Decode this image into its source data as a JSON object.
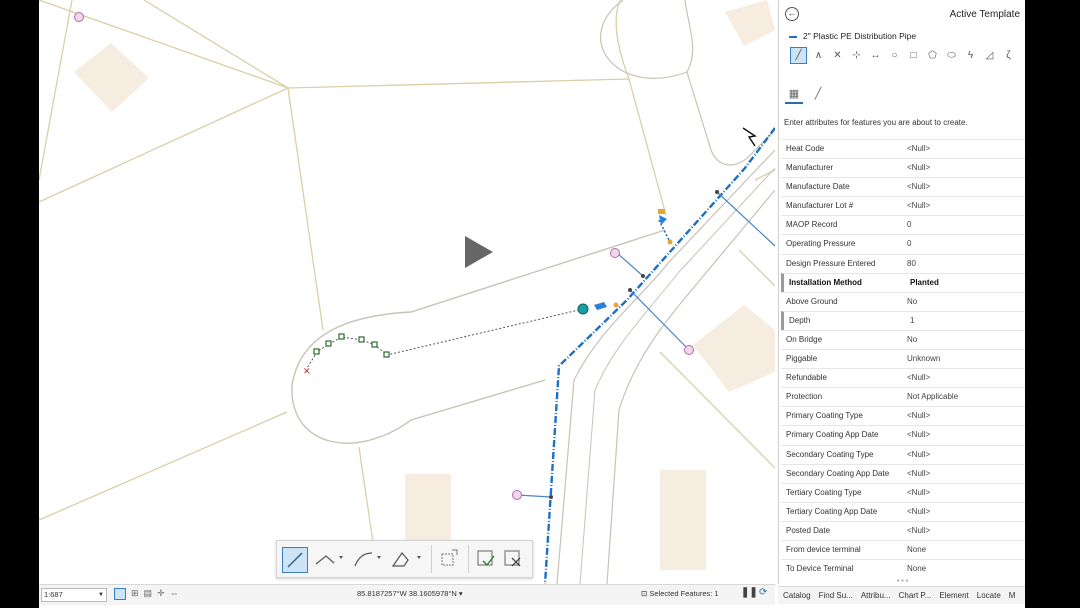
{
  "pane": {
    "title": "Active Template",
    "template_name": "2\" Plastic PE Distribution Pipe",
    "instructions": "Enter attributes for features you are about to create.",
    "attributes": [
      {
        "key": "Heat Code",
        "value": "<Null>"
      },
      {
        "key": "Manufacturer",
        "value": "<Null>"
      },
      {
        "key": "Manufacture Date",
        "value": "<Null>"
      },
      {
        "key": "Manufacturer Lot #",
        "value": "<Null>"
      },
      {
        "key": "MAOP Record",
        "value": "0"
      },
      {
        "key": "Operating Pressure",
        "value": "0"
      },
      {
        "key": "Design Pressure Entered",
        "value": "80"
      },
      {
        "key": "Installation Method",
        "value": "Planted",
        "bold": true,
        "marked": true
      },
      {
        "key": "Above Ground",
        "value": "No"
      },
      {
        "key": "Depth",
        "value": "1",
        "marked": true
      },
      {
        "key": "On Bridge",
        "value": "No"
      },
      {
        "key": "Piggable",
        "value": "Unknown"
      },
      {
        "key": "Refundable",
        "value": "<Null>"
      },
      {
        "key": "Protection",
        "value": "Not Applicable"
      },
      {
        "key": "Primary Coating Type",
        "value": "<Null>"
      },
      {
        "key": "Primary Coating App Date",
        "value": "<Null>"
      },
      {
        "key": "Secondary Coating Type",
        "value": "<Null>"
      },
      {
        "key": "Secondary Coating App Date",
        "value": "<Null>"
      },
      {
        "key": "Tertiary Coating Type",
        "value": "<Null>"
      },
      {
        "key": "Tertiary Coating App Date",
        "value": "<Null>"
      },
      {
        "key": "Posted Date",
        "value": "<Null>"
      },
      {
        "key": "From device terminal",
        "value": "None"
      },
      {
        "key": "To Device Terminal",
        "value": "None"
      }
    ]
  },
  "status": {
    "scale": "1:687",
    "coordinates": "85.8187257°W 38.1605978°N",
    "selected_features": "Selected Features: 1"
  },
  "bottom_tabs": [
    "Catalog",
    "Find Su...",
    "Attribu...",
    "Chart P...",
    "Element",
    "Locate",
    "M"
  ],
  "colors": {
    "parcel_line": "#d8d0a6",
    "pipe": "#1f6fc4",
    "building": "#f6ece0",
    "accent": "#3a7fc1"
  }
}
